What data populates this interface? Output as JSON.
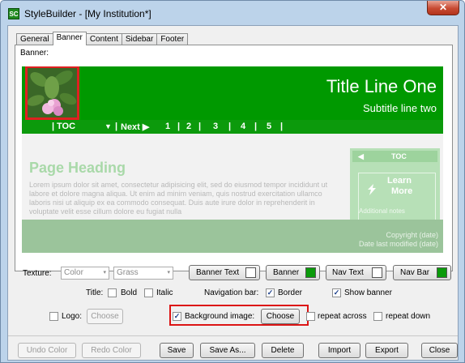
{
  "window": {
    "title": "StyleBuilder - [My Institution*]",
    "icon_text": "SC",
    "close_icon": "close-icon",
    "close_glyph": "✕"
  },
  "tabs": [
    {
      "label": "General",
      "active": false
    },
    {
      "label": "Banner",
      "active": true
    },
    {
      "label": "Content",
      "active": false
    },
    {
      "label": "Sidebar",
      "active": false
    },
    {
      "label": "Footer",
      "active": false
    }
  ],
  "banner_panel": {
    "label": "Banner:"
  },
  "preview": {
    "title_line": "Title Line One",
    "subtitle_line": "Subtitle line two",
    "nav": {
      "toc": "TOC",
      "dropdown_glyph": "▼",
      "next": "Next ▶",
      "pages": [
        "1",
        "2",
        "3",
        "4",
        "5"
      ],
      "sep": "|"
    },
    "page_heading": "Page Heading",
    "lorem": "Lorem ipsum dolor sit amet, consectetur adipisicing elit, sed do eiusmod tempor incididunt ut labore et dolore magna aliqua. Ut enim ad minim veniam, quis nostrud exercitation ullamco laboris nisi ut aliquip ex ea commodo consequat. Duis aute irure dolor in reprehenderit in voluptate velit esse cillum dolore eu fugiat nulla",
    "sidebar_toc": "TOC",
    "sidebar_arrow": "◀",
    "learn_more": [
      "Learn",
      "More"
    ],
    "additional_notes": "Additional notes",
    "copyright": "Copyright (date)",
    "date_modified": "Date last modified (date)",
    "colors": {
      "banner": "#009900",
      "nav_bar": "#0c9a0c",
      "thumbnail_border": "#e02020"
    }
  },
  "texture": {
    "label": "Texture:",
    "type_value": "Color",
    "pattern_value": "Grass",
    "arrow": "▾"
  },
  "color_buttons": [
    {
      "label": "Banner Text",
      "swatch": "#ffffff"
    },
    {
      "label": "Banner",
      "swatch": "#0a9a0a"
    },
    {
      "label": "Nav Text",
      "swatch": "#ffffff"
    },
    {
      "label": "Nav Bar",
      "swatch": "#0a9a0a"
    }
  ],
  "title_opts": {
    "label": "Title:",
    "bold": {
      "label": "Bold",
      "checked": false
    },
    "italic": {
      "label": "Italic",
      "checked": false
    }
  },
  "navigation_bar": {
    "label": "Navigation bar:",
    "border": {
      "label": "Border",
      "checked": true
    },
    "show_banner": {
      "label": "Show banner",
      "checked": true
    }
  },
  "logo": {
    "label": "Logo:",
    "checked": false,
    "choose": "Choose"
  },
  "background_image": {
    "label": "Background image:",
    "checked": true,
    "choose": "Choose"
  },
  "repeat_across": {
    "label": "repeat across",
    "checked": false
  },
  "repeat_down": {
    "label": "repeat down",
    "checked": false
  },
  "check_glyph": "✓",
  "bottom_buttons": {
    "undo": "Undo Color",
    "redo": "Redo Color",
    "save": "Save",
    "save_as": "Save As...",
    "delete": "Delete",
    "import": "Import",
    "export": "Export",
    "close": "Close"
  }
}
